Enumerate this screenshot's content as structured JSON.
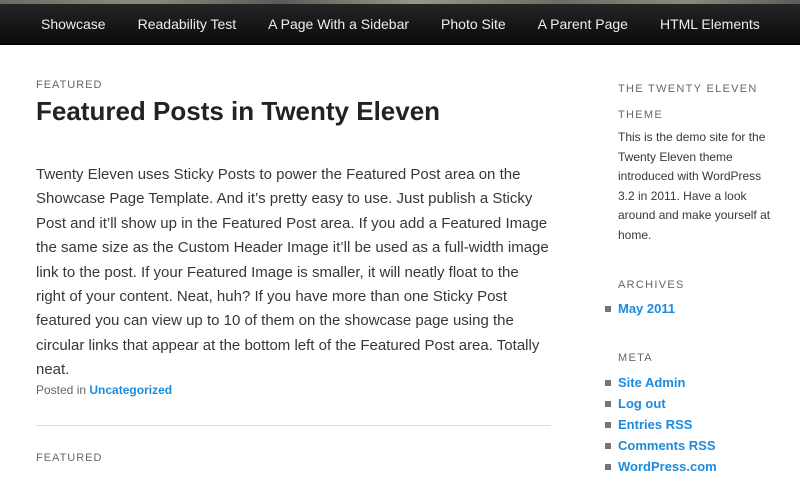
{
  "nav": {
    "items": [
      "Showcase",
      "Readability Test",
      "A Page With a Sidebar",
      "Photo Site",
      "A Parent Page",
      "HTML Elements"
    ]
  },
  "post1": {
    "label": "FEATURED",
    "title": "Featured Posts in Twenty Eleven",
    "body": "Twenty Eleven uses Sticky Posts to power the Featured Post area on the Showcase Page Template. And it’s pretty easy to use. Just publish a Sticky Post and it’ll show up in the Featured Post area. If you add a Featured Image the same size as the Custom Header Image it’ll be used as a full-width image link to the post. If your Featured Image is smaller, it will neatly float to the right of your content. Neat, huh? If you have more than one Sticky Post featured you can view up to 10 of them on the showcase page using the circular links that appear at the bottom left of the Featured Post area. Totally neat.",
    "posted_in": "Posted in",
    "category": "Uncategorized"
  },
  "post2": {
    "label": "FEATURED"
  },
  "sidebar": {
    "about": {
      "title": "THE TWENTY ELEVEN THEME",
      "text": "This is the demo site for the Twenty Eleven theme introduced with WordPress 3.2 in 2011. Have a look around and make yourself at home."
    },
    "archives": {
      "title": "ARCHIVES",
      "items": [
        "May 2011"
      ]
    },
    "meta": {
      "title": "META",
      "items": [
        "Site Admin",
        "Log out",
        "Entries RSS",
        "Comments RSS",
        "WordPress.com"
      ]
    }
  },
  "colors": {
    "link": "#1b8be0",
    "nav_bg": "#1a1a1a",
    "nav_text": "#eeeeee"
  }
}
